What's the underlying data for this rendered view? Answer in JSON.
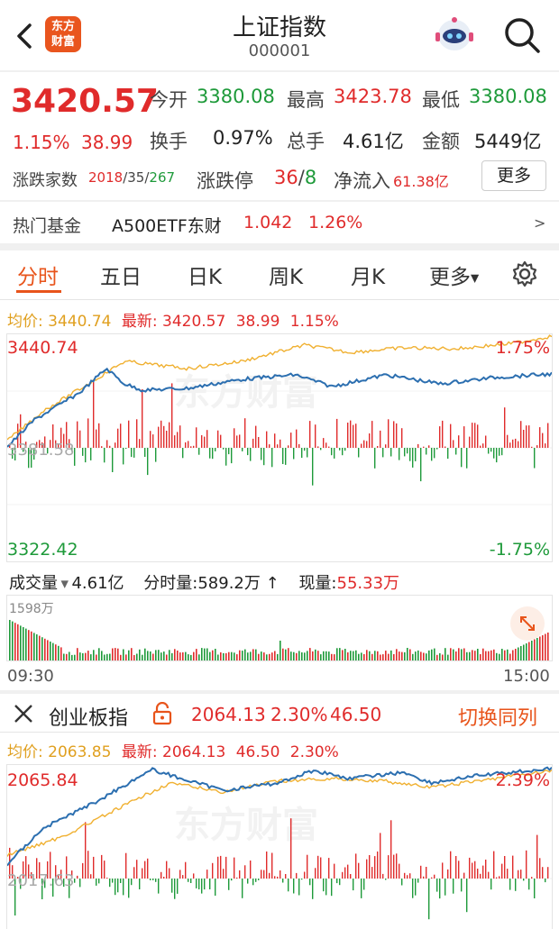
{
  "header": {
    "title": "上证指数",
    "code": "000001",
    "logo_text": "东方财富"
  },
  "quote": {
    "price": "3420.57",
    "change_pct": "1.15%",
    "change": "38.99",
    "open_label": "今开",
    "open_value": "3380.08",
    "high_label": "最高",
    "high_value": "3423.78",
    "low_label": "最低",
    "low_value": "3380.08",
    "turnover_label": "换手",
    "turnover_value": "0.97%",
    "volume_label": "总手",
    "volume_value": "4.61亿",
    "amount_label": "金额",
    "amount_value": "5449亿",
    "breadth_label": "涨跌家数",
    "breadth_up": "2018",
    "breadth_flat": "35",
    "breadth_down": "267",
    "limit_label": "涨跌停",
    "limit_up": "36",
    "limit_down": "8",
    "inflow_label": "净流入",
    "inflow_value": "61.38亿",
    "more_button": "更多"
  },
  "fund": {
    "label": "热门基金",
    "name": "A500ETF东财",
    "price": "1.042",
    "change": "1.26%",
    "arrow": ">"
  },
  "tabs": [
    {
      "label": "分时"
    },
    {
      "label": "五日"
    },
    {
      "label": "日K"
    },
    {
      "label": "周K"
    },
    {
      "label": "月K"
    },
    {
      "label": "更多"
    }
  ],
  "main_chart": {
    "avg_label": "均价:",
    "avg_value": "3440.74",
    "latest_label": "最新:",
    "latest_value": "3420.57",
    "latest_change": "38.99",
    "latest_pct": "1.15%",
    "y_top": "3440.74",
    "y_mid": "3381.58",
    "y_bottom": "3322.42",
    "pct_top": "1.75%",
    "pct_bottom": "-1.75%",
    "watermark": "东方财富"
  },
  "volume_bar": {
    "label": "成交量",
    "total": "4.61亿",
    "minute_label": "分时量:",
    "minute_value": "589.2万",
    "minute_arrow": "↑",
    "current_label": "现量:",
    "current_value": "55.33万",
    "max_label": "1598万",
    "time_start": "09:30",
    "time_end": "15:00"
  },
  "sub_index": {
    "name": "创业板指",
    "price": "2064.13",
    "pct": "2.30%",
    "change": "46.50",
    "switch_label": "切换同列"
  },
  "sub_chart": {
    "avg_label": "均价:",
    "avg_value": "2063.85",
    "latest_label": "最新:",
    "latest_value": "2064.13",
    "latest_change": "46.50",
    "latest_pct": "2.30%",
    "y_top": "2065.84",
    "y_mid": "2017.63",
    "pct_top": "2.39%",
    "watermark": "东方财富"
  },
  "colors": {
    "up": "#e02b2b",
    "down": "#1e9a3a",
    "accent": "#e8541b",
    "price_line": "#2c6fb0",
    "avg_line": "#f0b030"
  }
}
